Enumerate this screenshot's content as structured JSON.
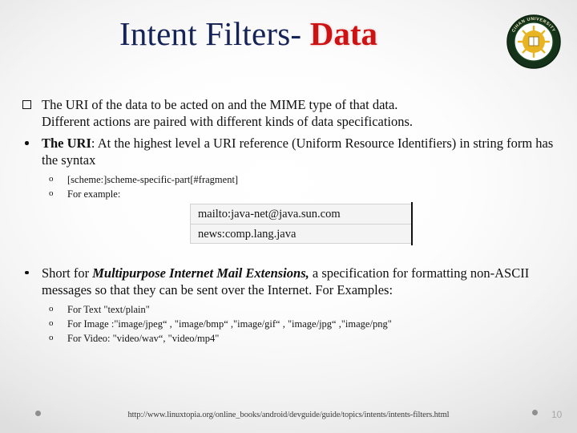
{
  "slide": {
    "title_main": "Intent Filters-",
    "title_accent": "Data",
    "logo_alt": "university-seal-logo",
    "logo_ring_text": "CIHAN UNIVERSITY",
    "colors": {
      "title_navy": "#162357",
      "title_red": "#cc1212",
      "logo_ring": "#1b3a1f",
      "logo_sun": "#e8b422",
      "box_fill": "#f4f4f4",
      "page_number": "#a8a8a8"
    }
  },
  "content": {
    "bullet1": {
      "marker": "hollow-square",
      "line1": "The URI of the data to be acted on and the MIME type of that data.",
      "line2": "Different actions are paired with different kinds of data specifications."
    },
    "bullet2": {
      "marker": "round-dot",
      "lead_bold": "The URI",
      "rest": ": At the highest level a URI reference (Uniform Resource Identifiers) in string form has the syntax",
      "subitems": [
        {
          "marker": "o",
          "text": "[scheme:]scheme-specific-part[#fragment]"
        },
        {
          "marker": "o",
          "text": "For example:"
        }
      ]
    },
    "example_boxes": [
      "mailto:java-net@java.sun.com",
      "news:comp.lang.java"
    ],
    "bullet3": {
      "marker": "round-dot",
      "pre": "Short for ",
      "emph": "Multipurpose Internet Mail Extensions,",
      "post": " a specification for formatting non-ASCII messages so that they can be sent over the Internet. For Examples:",
      "subitems": [
        {
          "marker": "o",
          "text": "For Text  \"text/plain\""
        },
        {
          "marker": "o",
          "text": "For Image :\"image/jpeg“ , \"image/bmp“ ,\"image/gif“ , \"image/jpg“ ,\"image/png\""
        },
        {
          "marker": "o",
          "text": "For Video: \"video/wav“, \"video/mp4\""
        }
      ]
    }
  },
  "footer": {
    "url": "http://www.linuxtopia.org/online_books/android/devguide/guide/topics/intents/intents-filters.html",
    "page_number": "10"
  }
}
